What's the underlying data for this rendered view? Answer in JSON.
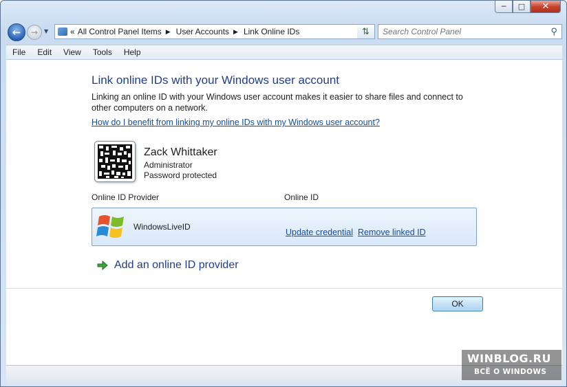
{
  "window": {
    "minimize_label": "─",
    "maximize_label": "□",
    "close_label": "✕"
  },
  "nav": {
    "breadcrumb_overflow": "«",
    "breadcrumb": [
      "All Control Panel Items",
      "User Accounts",
      "Link Online IDs"
    ],
    "search_placeholder": "Search Control Panel"
  },
  "menu": [
    "File",
    "Edit",
    "View",
    "Tools",
    "Help"
  ],
  "main": {
    "heading": "Link online IDs with your Windows user account",
    "description": "Linking an online ID with your Windows user account makes it easier to share files and connect to other computers on a network.",
    "help_link": "How do I benefit from linking my online IDs with my Windows user account?",
    "user": {
      "name": "Zack Whittaker",
      "role": "Administrator",
      "password_status": "Password protected"
    },
    "columns": {
      "provider": "Online ID Provider",
      "online_id": "Online ID"
    },
    "providers": [
      {
        "name": "WindowsLiveID",
        "icon": "windows-logo-icon",
        "update_label": "Update credential",
        "remove_label": "Remove linked ID"
      }
    ],
    "add_provider_label": "Add an online ID provider",
    "ok_label": "OK"
  },
  "watermark": {
    "line1": "WINBLOG.RU",
    "line2": "ВСЁ О WINDOWS"
  },
  "colors": {
    "heading": "#1e3d8f",
    "link": "#0f4fa8",
    "row_border": "#7da2ce"
  }
}
